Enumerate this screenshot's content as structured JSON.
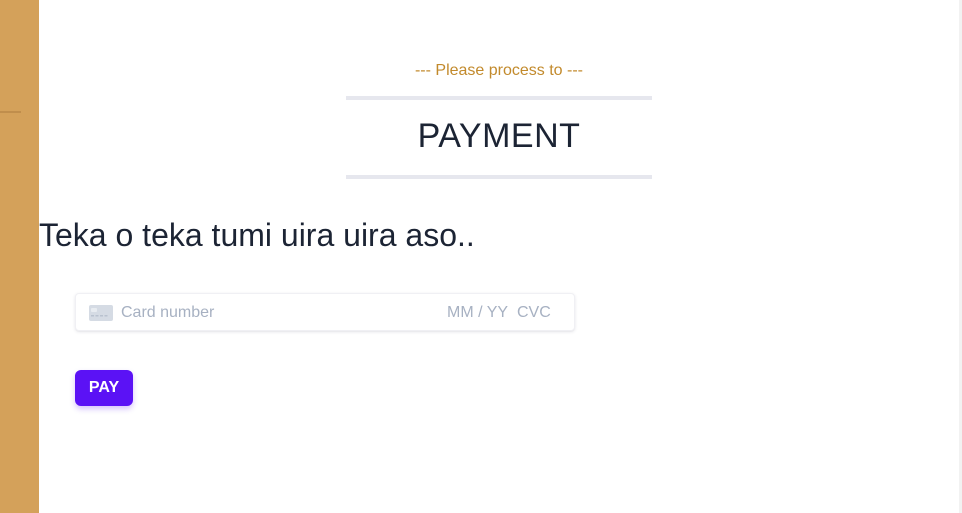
{
  "header": {
    "subtitle": "--- Please process to ---",
    "title": "PAYMENT"
  },
  "main": {
    "heading": "Teka o teka tumi uira uira aso.."
  },
  "card_form": {
    "card_number_placeholder": "Card number",
    "expiry_placeholder": "MM / YY",
    "cvc_placeholder": "CVC",
    "card_icon": "credit-card-icon"
  },
  "actions": {
    "pay_label": "PAY"
  },
  "colors": {
    "sidebar": "#d4a15a",
    "subtitle": "#c28a2c",
    "title": "#1c2434",
    "placeholder": "#a7b1c2",
    "pay_button": "#5b12f5"
  }
}
